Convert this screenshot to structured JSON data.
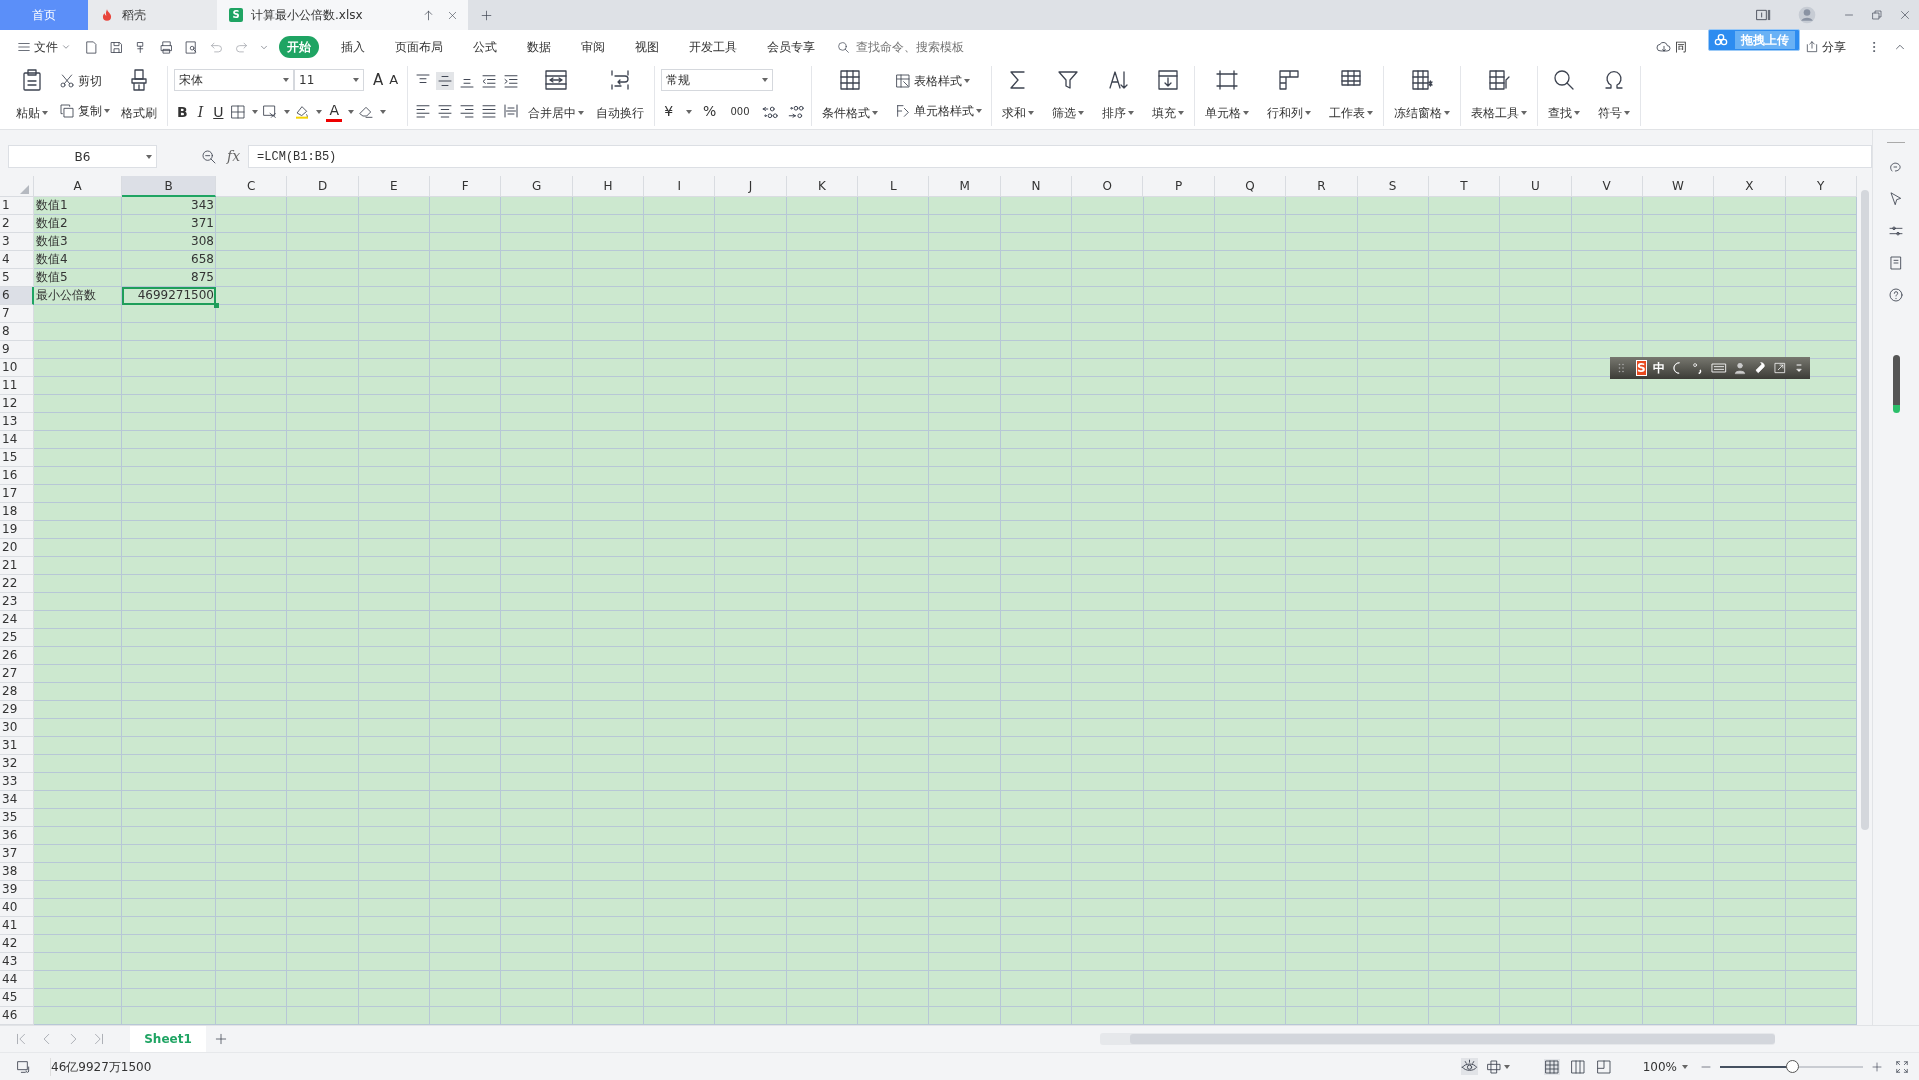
{
  "title_tabs": [
    {
      "label": "首页",
      "kind": "home",
      "selected": false
    },
    {
      "label": "稻壳",
      "kind": "docer",
      "selected": false
    },
    {
      "label": "计算最小公倍数.xlsx",
      "kind": "file",
      "selected": true,
      "badge": "S"
    }
  ],
  "menu": {
    "file_label": "文件",
    "tabs": [
      {
        "label": "开始",
        "selected": true
      },
      {
        "label": "插入",
        "selected": false
      },
      {
        "label": "页面布局",
        "selected": false
      },
      {
        "label": "公式",
        "selected": false
      },
      {
        "label": "数据",
        "selected": false
      },
      {
        "label": "审阅",
        "selected": false
      },
      {
        "label": "视图",
        "selected": false
      },
      {
        "label": "开发工具",
        "selected": false
      },
      {
        "label": "会员专享",
        "selected": false
      }
    ],
    "search": {
      "placeholder": "查找命令、搜索模板"
    },
    "sync_label": "同",
    "share_label": "分享"
  },
  "upload_popup": {
    "label": "拖拽上传"
  },
  "ribbon": {
    "clipboard": [
      {
        "label": "粘贴",
        "kind": "large",
        "dropdown": true
      },
      {
        "label": "剪切",
        "kind": "small",
        "dropdown": false
      },
      {
        "label": "复制",
        "kind": "small",
        "dropdown": true
      },
      {
        "label": "格式刷",
        "kind": "large",
        "dropdown": false
      }
    ],
    "font": {
      "name": "宋体",
      "size": "11",
      "grow": "A",
      "shrink": "A",
      "bold": "B",
      "italic": "I",
      "underline": "U",
      "font_color": "A"
    },
    "alignment": [
      {
        "label": "合并居中",
        "kind": "large",
        "dropdown": true
      },
      {
        "label": "自动换行",
        "kind": "large",
        "dropdown": false
      }
    ],
    "number": {
      "format": "常规",
      "currency": "¥",
      "percent": "%",
      "thousands": "000"
    },
    "groups": [
      [
        {
          "label": "条件格式",
          "kind": "large",
          "dropdown": true
        },
        {
          "label": "表格样式",
          "kind": "small",
          "dropdown": true
        },
        {
          "label": "单元格样式",
          "kind": "small",
          "dropdown": true
        }
      ],
      [
        {
          "label": "求和",
          "kind": "large",
          "dropdown": true
        },
        {
          "label": "筛选",
          "kind": "large",
          "dropdown": true
        },
        {
          "label": "排序",
          "kind": "large",
          "dropdown": true
        },
        {
          "label": "填充",
          "kind": "large",
          "dropdown": true
        }
      ],
      [
        {
          "label": "单元格",
          "kind": "large",
          "dropdown": true
        },
        {
          "label": "行和列",
          "kind": "large",
          "dropdown": true
        },
        {
          "label": "工作表",
          "kind": "large",
          "dropdown": true
        }
      ],
      [
        {
          "label": "冻结窗格",
          "kind": "large",
          "dropdown": true
        }
      ],
      [
        {
          "label": "表格工具",
          "kind": "large",
          "dropdown": true
        }
      ],
      [
        {
          "label": "查找",
          "kind": "large",
          "dropdown": true
        },
        {
          "label": "符号",
          "kind": "large",
          "dropdown": true
        }
      ]
    ]
  },
  "formula_bar": {
    "name_box": "B6",
    "fx": "fx",
    "formula": "=LCM(B1:B5)"
  },
  "sheet": {
    "columns": [
      {
        "label": "A",
        "selected": false
      },
      {
        "label": "B",
        "selected": true
      },
      {
        "label": "C",
        "selected": false
      },
      {
        "label": "D",
        "selected": false
      },
      {
        "label": "E",
        "selected": false
      },
      {
        "label": "F",
        "selected": false
      },
      {
        "label": "G",
        "selected": false
      },
      {
        "label": "H",
        "selected": false
      },
      {
        "label": "I",
        "selected": false
      },
      {
        "label": "J",
        "selected": false
      },
      {
        "label": "K",
        "selected": false
      },
      {
        "label": "L",
        "selected": false
      },
      {
        "label": "M",
        "selected": false
      },
      {
        "label": "N",
        "selected": false
      },
      {
        "label": "O",
        "selected": false
      },
      {
        "label": "P",
        "selected": false
      },
      {
        "label": "Q",
        "selected": false
      },
      {
        "label": "R",
        "selected": false
      },
      {
        "label": "S",
        "selected": false
      },
      {
        "label": "T",
        "selected": false
      },
      {
        "label": "U",
        "selected": false
      },
      {
        "label": "V",
        "selected": false
      },
      {
        "label": "W",
        "selected": false
      },
      {
        "label": "X",
        "selected": false
      },
      {
        "label": "Y",
        "selected": false
      }
    ],
    "rows": [
      {
        "label": "1",
        "selected": false,
        "cells": [
          "数值1",
          "343"
        ]
      },
      {
        "label": "2",
        "selected": false,
        "cells": [
          "数值2",
          "371"
        ]
      },
      {
        "label": "3",
        "selected": false,
        "cells": [
          "数值3",
          "308"
        ]
      },
      {
        "label": "4",
        "selected": false,
        "cells": [
          "数值4",
          "658"
        ]
      },
      {
        "label": "5",
        "selected": false,
        "cells": [
          "数值5",
          "875"
        ]
      },
      {
        "label": "6",
        "selected": true,
        "cells": [
          "最小公倍数",
          "4699271500"
        ]
      },
      {
        "label": "7",
        "selected": false
      },
      {
        "label": "8",
        "selected": false
      },
      {
        "label": "9",
        "selected": false
      },
      {
        "label": "10",
        "selected": false
      },
      {
        "label": "11",
        "selected": false
      },
      {
        "label": "12",
        "selected": false
      },
      {
        "label": "13",
        "selected": false
      },
      {
        "label": "14",
        "selected": false
      },
      {
        "label": "15",
        "selected": false
      },
      {
        "label": "16",
        "selected": false
      },
      {
        "label": "17",
        "selected": false
      },
      {
        "label": "18",
        "selected": false
      },
      {
        "label": "19",
        "selected": false
      },
      {
        "label": "20",
        "selected": false
      },
      {
        "label": "21",
        "selected": false
      },
      {
        "label": "22",
        "selected": false
      },
      {
        "label": "23",
        "selected": false
      },
      {
        "label": "24",
        "selected": false
      },
      {
        "label": "25",
        "selected": false
      },
      {
        "label": "26",
        "selected": false
      },
      {
        "label": "27",
        "selected": false
      },
      {
        "label": "28",
        "selected": false
      },
      {
        "label": "29",
        "selected": false
      },
      {
        "label": "30",
        "selected": false
      },
      {
        "label": "31",
        "selected": false
      },
      {
        "label": "32",
        "selected": false
      },
      {
        "label": "33",
        "selected": false
      },
      {
        "label": "34",
        "selected": false
      },
      {
        "label": "35",
        "selected": false
      },
      {
        "label": "36",
        "selected": false
      },
      {
        "label": "37",
        "selected": false
      },
      {
        "label": "38",
        "selected": false
      },
      {
        "label": "39",
        "selected": false
      },
      {
        "label": "40",
        "selected": false
      },
      {
        "label": "41",
        "selected": false
      },
      {
        "label": "42",
        "selected": false
      },
      {
        "label": "43",
        "selected": false
      },
      {
        "label": "44",
        "selected": false
      },
      {
        "label": "45",
        "selected": false
      },
      {
        "label": "46",
        "selected": false
      }
    ]
  },
  "ime_toolbar": {
    "logo": "S",
    "mode": "中"
  },
  "sheet_tabs": [
    {
      "label": "Sheet1",
      "selected": true
    }
  ],
  "status_bar": {
    "text": "46亿9927万1500",
    "zoom": {
      "label": "100%",
      "level": 0.5
    }
  }
}
